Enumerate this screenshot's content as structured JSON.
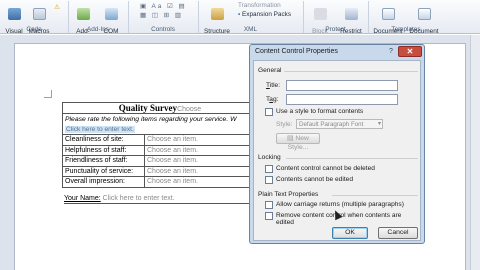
{
  "ribbon": {
    "visual_basic": "Visual\nBasic",
    "macros": "Macros",
    "macro_security": "Macro Security",
    "addins": "Add-Ins",
    "com_addins": "COM\nAdd-Ins",
    "structure": "Structure",
    "transformation": "Transformation",
    "expansion_packs": "Expansion Packs",
    "block_authors": "Block\nAuthors",
    "restrict_editing": "Restrict\nEditing",
    "document_template": "Document\nTemplate",
    "document_panel": "Document\nPanel",
    "groups": [
      "Code",
      "Add-Ins",
      "Controls",
      "XML",
      "Protect",
      "Templates"
    ]
  },
  "document": {
    "title": "Quality Survey",
    "title_control": "Choose",
    "instruction": "Please rate the following items regarding your service. W",
    "click_here": "Click here to enter text.",
    "rows": [
      {
        "label": "Cleanliness of site:",
        "value": "Choose an item."
      },
      {
        "label": "Helpfulness of staff:",
        "value": "Choose an item."
      },
      {
        "label": "Friendliness of staff:",
        "value": "Choose an item."
      },
      {
        "label": "Punctuality of service:",
        "value": "Choose an item."
      },
      {
        "label": "Overall impression:",
        "value": "Choose an item."
      }
    ],
    "name_label": "Your Name:",
    "name_placeholder": "Click here to enter text."
  },
  "dialog": {
    "title": "Content Control Properties",
    "help": "?",
    "close": "✕",
    "general": "General",
    "title_label": "Title:",
    "tag_label": "Tag:",
    "use_style": "Use a style to format contents",
    "style_label": "Style:",
    "style_value": "Default Paragraph Font",
    "new_style": "New Style...",
    "locking": "Locking",
    "cannot_delete": "Content control cannot be deleted",
    "cannot_edit": "Contents cannot be edited",
    "plain_text": "Plain Text Properties",
    "allow_returns": "Allow carriage returns (multiple paragraphs)",
    "remove_when_edited": "Remove content control when contents are edited",
    "ok": "OK",
    "cancel": "Cancel"
  }
}
